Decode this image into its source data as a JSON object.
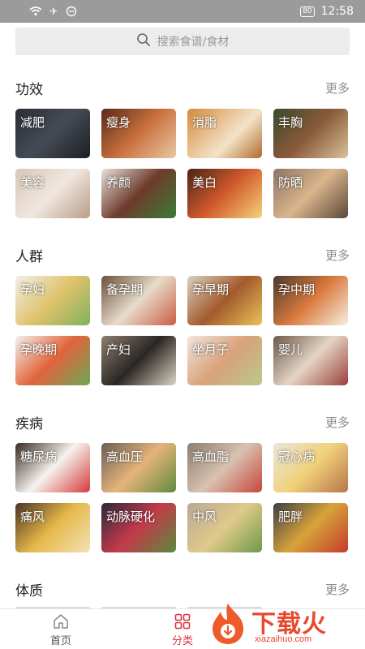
{
  "status_bar": {
    "time": "12:58",
    "battery": "80"
  },
  "search": {
    "placeholder": "搜索食谱/食材"
  },
  "sections": [
    {
      "title": "功效",
      "more": "更多",
      "items": [
        {
          "label": "减肥"
        },
        {
          "label": "瘦身"
        },
        {
          "label": "消脂"
        },
        {
          "label": "丰胸"
        },
        {
          "label": "美容"
        },
        {
          "label": "养颜"
        },
        {
          "label": "美白"
        },
        {
          "label": "防晒"
        }
      ]
    },
    {
      "title": "人群",
      "more": "更多",
      "items": [
        {
          "label": "孕妇"
        },
        {
          "label": "备孕期"
        },
        {
          "label": "孕早期"
        },
        {
          "label": "孕中期"
        },
        {
          "label": "孕晚期"
        },
        {
          "label": "产妇"
        },
        {
          "label": "坐月子"
        },
        {
          "label": "婴儿"
        }
      ]
    },
    {
      "title": "疾病",
      "more": "更多",
      "items": [
        {
          "label": "糖尿病"
        },
        {
          "label": "高血压"
        },
        {
          "label": "高血脂"
        },
        {
          "label": "冠心病"
        },
        {
          "label": "痛风"
        },
        {
          "label": "动脉硬化"
        },
        {
          "label": "中风"
        },
        {
          "label": "肥胖"
        }
      ]
    },
    {
      "title": "体质",
      "more": "更多",
      "items": []
    }
  ],
  "tab_bar": {
    "home": "首页",
    "category": "分类",
    "active": "category",
    "active_color": "#d9343e"
  },
  "watermark": {
    "brand": "下载火",
    "domain": "xiazaihuo.com"
  }
}
